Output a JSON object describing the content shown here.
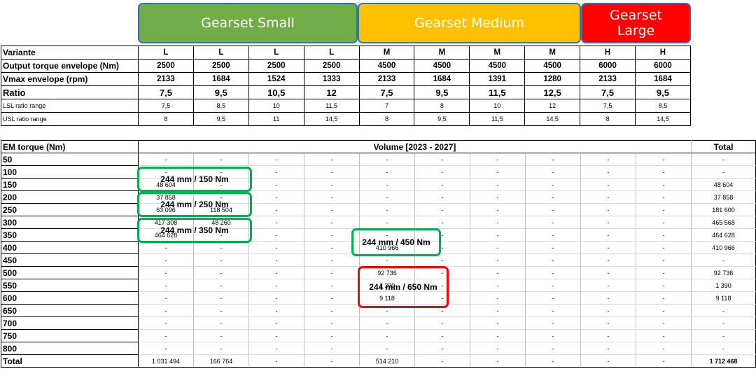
{
  "headers": [
    {
      "label": "Gearset Small",
      "color": "#70ad47"
    },
    {
      "label": "Gearset Medium",
      "color": "#ffc000"
    },
    {
      "label": "Gearset Large",
      "color": "#ff0000"
    }
  ],
  "specs": {
    "rows": [
      {
        "label": "Variante",
        "values": [
          "L",
          "L",
          "L",
          "L",
          "M",
          "M",
          "M",
          "M",
          "H",
          "H"
        ]
      },
      {
        "label": "Output torque envelope (Nm)",
        "values": [
          "2500",
          "2500",
          "2500",
          "2500",
          "4500",
          "4500",
          "4500",
          "4500",
          "6000",
          "6000"
        ]
      },
      {
        "label": "Vmax envelope (rpm)",
        "values": [
          "2133",
          "1684",
          "1524",
          "1333",
          "2133",
          "1684",
          "1391",
          "1280",
          "2133",
          "1684"
        ]
      },
      {
        "label": "Ratio",
        "values": [
          "7,5",
          "9,5",
          "10,5",
          "12",
          "7,5",
          "9,5",
          "11,5",
          "12,5",
          "7,5",
          "9,5"
        ]
      },
      {
        "label": "LSL ratio range",
        "values": [
          "7,5",
          "8,5",
          "10",
          "11,5",
          "7",
          "8",
          "10",
          "12",
          "7,5",
          "8,5"
        ]
      },
      {
        "label": "USL ratio range",
        "values": [
          "8",
          "9,5",
          "11",
          "14,5",
          "8",
          "9,5",
          "11,5",
          "14,5",
          "8",
          "14,5"
        ]
      }
    ]
  },
  "volume": {
    "col_header": "EM torque (Nm)",
    "volume_header": "Volume [2023 - 2027]",
    "total_header": "Total",
    "rows": [
      {
        "label": "50",
        "values": [
          "-",
          "-",
          "-",
          "-",
          "-",
          "-",
          "-",
          "-",
          "-",
          "-"
        ],
        "total": "-"
      },
      {
        "label": "100",
        "values": [
          "-",
          "-",
          "-",
          "-",
          "-",
          "-",
          "-",
          "-",
          "-",
          "-"
        ],
        "total": "-"
      },
      {
        "label": "150",
        "values": [
          "48 604",
          "-",
          "-",
          "-",
          "-",
          "-",
          "-",
          "-",
          "-",
          "-"
        ],
        "total": "48 604"
      },
      {
        "label": "200",
        "values": [
          "37 858",
          "-",
          "-",
          "-",
          "-",
          "-",
          "-",
          "-",
          "-",
          "-"
        ],
        "total": "37 858"
      },
      {
        "label": "250",
        "values": [
          "63 096",
          "118 504",
          "-",
          "-",
          "-",
          "-",
          "-",
          "-",
          "-",
          "-"
        ],
        "total": "181 600"
      },
      {
        "label": "300",
        "values": [
          "417 308",
          "48 260",
          "-",
          "-",
          "-",
          "-",
          "-",
          "-",
          "-",
          "-"
        ],
        "total": "465 568"
      },
      {
        "label": "350",
        "values": [
          "464 628",
          "-",
          "-",
          "-",
          "-",
          "-",
          "-",
          "-",
          "-",
          "-"
        ],
        "total": "464 628"
      },
      {
        "label": "400",
        "values": [
          "-",
          "-",
          "-",
          "-",
          "410 966",
          "-",
          "-",
          "-",
          "-",
          "-"
        ],
        "total": "410 966"
      },
      {
        "label": "450",
        "values": [
          "-",
          "-",
          "-",
          "-",
          "-",
          "-",
          "-",
          "-",
          "-",
          "-"
        ],
        "total": "-"
      },
      {
        "label": "500",
        "values": [
          "-",
          "-",
          "-",
          "-",
          "92 736",
          "-",
          "-",
          "-",
          "-",
          "-"
        ],
        "total": "92 736"
      },
      {
        "label": "550",
        "values": [
          "-",
          "-",
          "-",
          "-",
          "1 390",
          "-",
          "-",
          "-",
          "-",
          "-"
        ],
        "total": "1 390"
      },
      {
        "label": "600",
        "values": [
          "-",
          "-",
          "-",
          "-",
          "9 118",
          "-",
          "-",
          "-",
          "-",
          "-"
        ],
        "total": "9 118"
      },
      {
        "label": "650",
        "values": [
          "-",
          "-",
          "-",
          "-",
          "-",
          "-",
          "-",
          "-",
          "-",
          "-"
        ],
        "total": "-"
      },
      {
        "label": "700",
        "values": [
          "-",
          "-",
          "-",
          "-",
          "-",
          "-",
          "-",
          "-",
          "-",
          "-"
        ],
        "total": "-"
      },
      {
        "label": "750",
        "values": [
          "-",
          "-",
          "-",
          "-",
          "-",
          "-",
          "-",
          "-",
          "-",
          "-"
        ],
        "total": "-"
      },
      {
        "label": "800",
        "values": [
          "-",
          "-",
          "-",
          "-",
          "-",
          "-",
          "-",
          "-",
          "-",
          "-"
        ],
        "total": "-"
      },
      {
        "label": "Total",
        "values": [
          "1 031 494",
          "166 764",
          "-",
          "-",
          "514 210",
          "-",
          "-",
          "-",
          "-",
          "-"
        ],
        "total": "1 712 468"
      }
    ]
  },
  "annotations": [
    {
      "label": "244 mm / 150 Nm",
      "color": "green"
    },
    {
      "label": "244 mm / 250 Nm",
      "color": "green"
    },
    {
      "label": "244 mm / 350 Nm",
      "color": "green"
    },
    {
      "label": "244 mm / 450 Nm",
      "color": "green"
    },
    {
      "label": "244 mm / 650 Nm",
      "color": "red"
    }
  ]
}
